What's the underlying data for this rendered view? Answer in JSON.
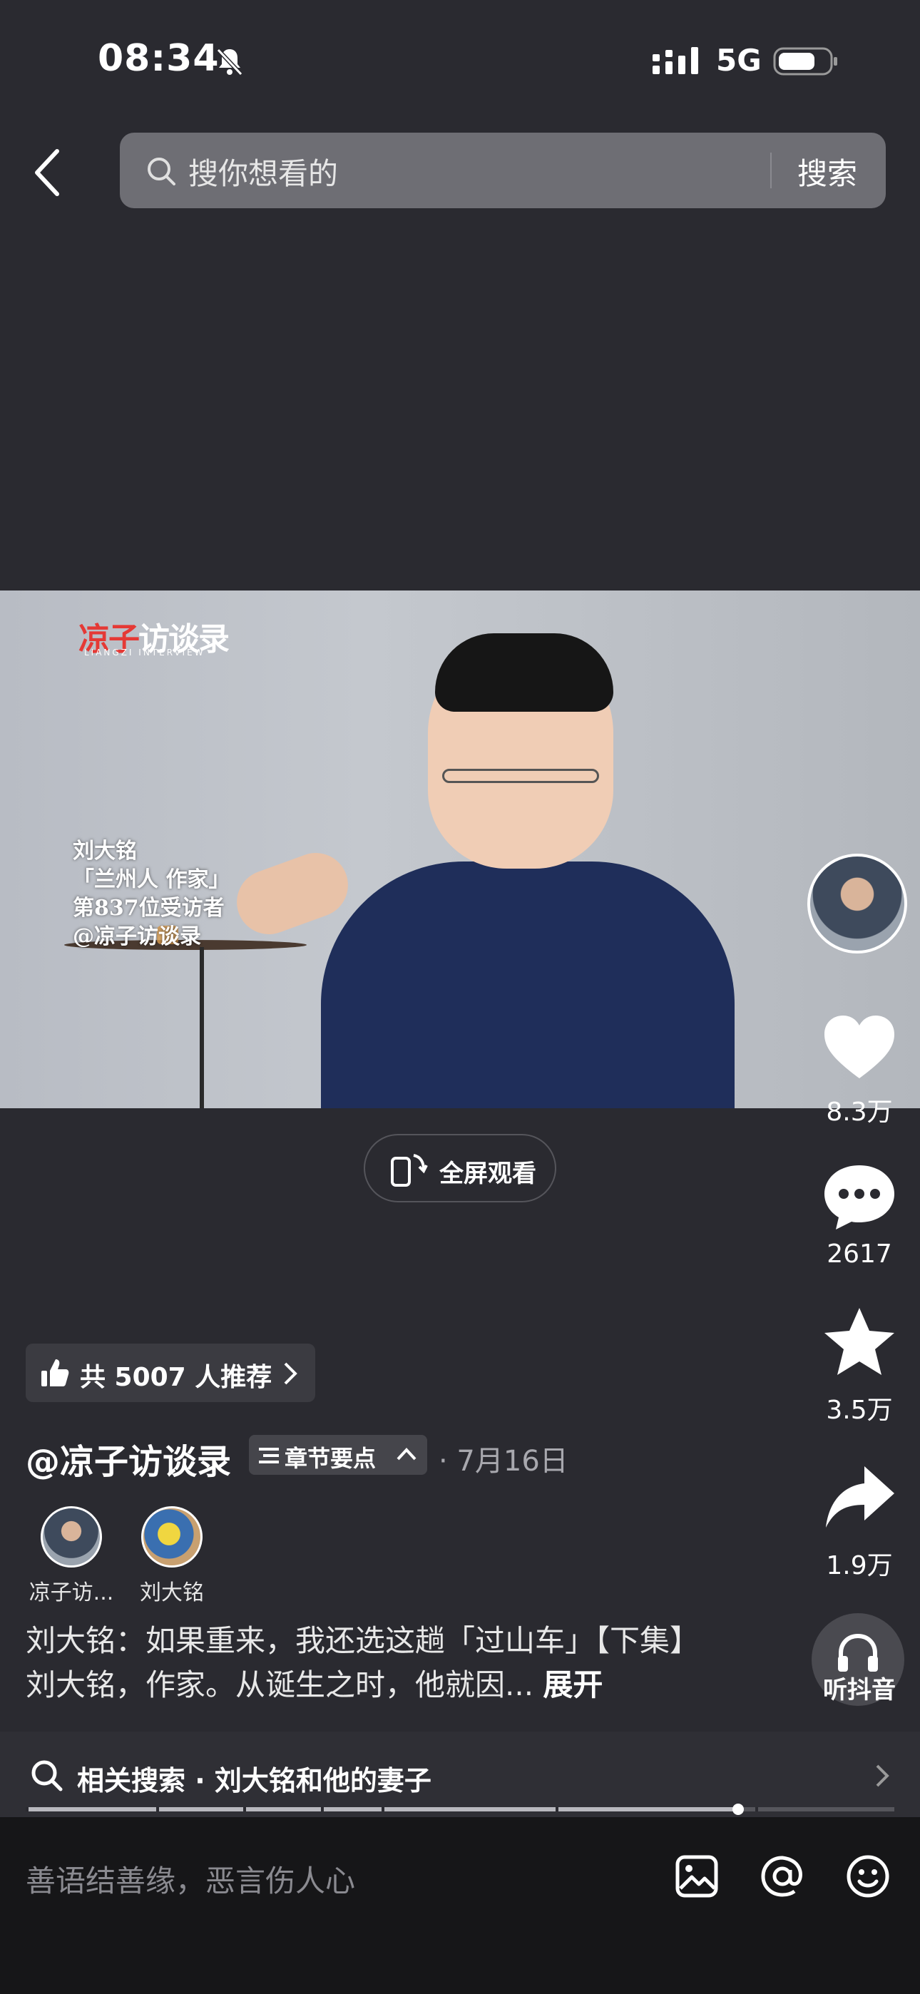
{
  "status_bar": {
    "time": "08:34",
    "network": "5G"
  },
  "search": {
    "placeholder": "搜你想看的",
    "button_label": "搜索"
  },
  "video": {
    "logo_main": "凉子",
    "logo_main_2": "访谈录",
    "logo_sub": "LIANGZI INTERVIEW",
    "captions": [
      "刘大铭",
      "「兰州人 作家」",
      "第837位受访者",
      "@凉子访谈录"
    ]
  },
  "fullscreen": {
    "label": "全屏观看"
  },
  "actions": {
    "likes": "8.3万",
    "comments": "2617",
    "favorites": "3.5万",
    "shares": "1.9万",
    "listen_label": "听抖音"
  },
  "recommend": {
    "text": "共 5007 人推荐"
  },
  "post": {
    "author": "@凉子访谈录",
    "chapter_label": "章节要点",
    "date": "· 7月16日",
    "coauthors": [
      {
        "name": "凉子访..."
      },
      {
        "name": "刘大铭"
      }
    ],
    "description": "刘大铭：如果重来，我还选这趟「过山车」【下集】 刘大铭，作家。从诞生之时，他就因...",
    "expand_label": "展开"
  },
  "related_search": {
    "text": "相关搜索 · 刘大铭和他的妻子"
  },
  "playback": {
    "progress": 0.82,
    "chapter_ticks": [
      0.0,
      0.15,
      0.25,
      0.34,
      0.41,
      0.61,
      0.84
    ]
  },
  "comment_bar": {
    "placeholder": "善语结善缘，恶言伤人心"
  },
  "icons": [
    "bell-off-icon",
    "signal-icon",
    "battery-icon",
    "back-icon",
    "search-icon",
    "heart-icon",
    "comment-icon",
    "star-icon",
    "share-icon",
    "headphones-icon",
    "rotate-phone-icon",
    "thumbs-up-icon",
    "chevron-right-icon",
    "list-icon",
    "chevron-up-icon",
    "image-icon",
    "at-icon",
    "emoji-icon"
  ]
}
